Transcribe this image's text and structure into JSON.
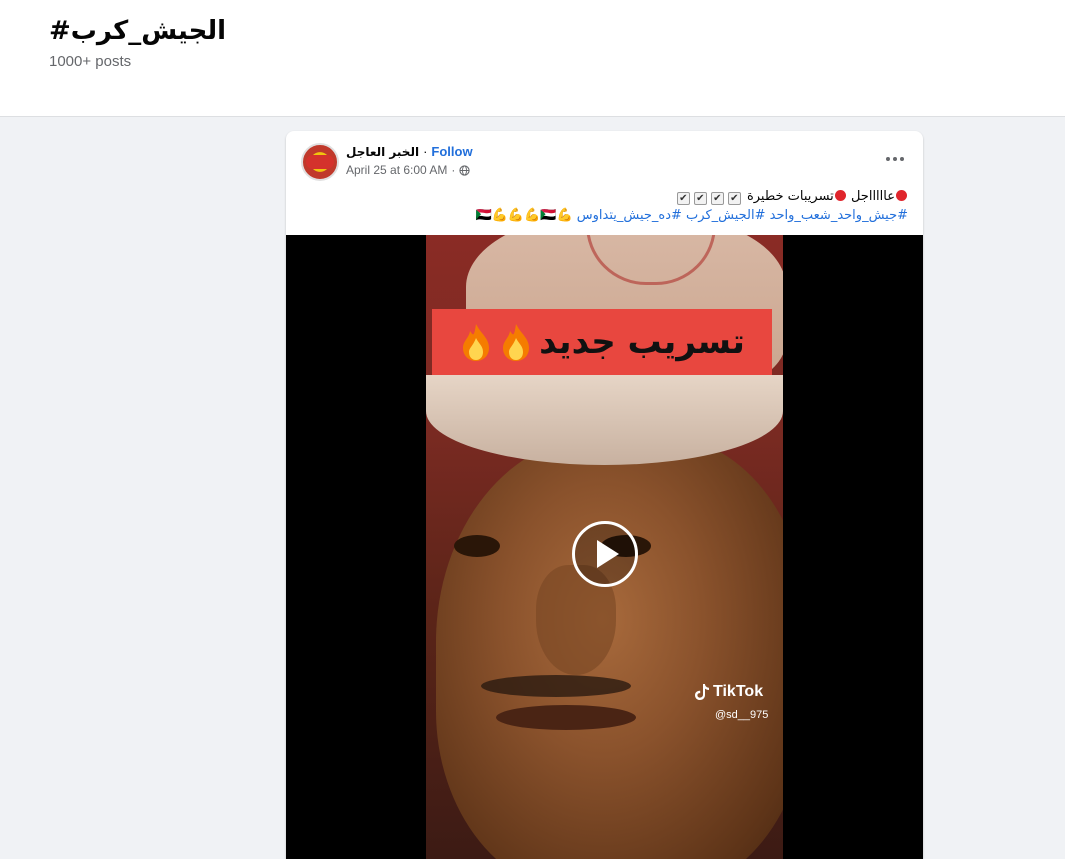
{
  "hashtag": {
    "title": "#الجيش_كرب",
    "post_count": "1000+ posts"
  },
  "post": {
    "page_name": "الخبر العاجل",
    "separator": "·",
    "follow_label": "Follow",
    "timestamp": "April 25 at 6:00 AM",
    "meta_separator": "·",
    "privacy_icon": "globe-icon",
    "more_icon": "more-options-icon",
    "caption": {
      "line1_part1": "عاااااجل",
      "line1_part2": "تسريبات خطيرة",
      "line2": "#جيش_واحد_شعب_واحد #الجيش_كرب #ده_جيش_يتداوس 💪🇸🇩💪💪💪🇸🇩"
    },
    "video": {
      "banner_text": "تسريب جديد",
      "watermark_brand": "TikTok",
      "watermark_handle": "@sd__975",
      "play_icon": "play-icon"
    }
  },
  "colors": {
    "accent": "#216fdb",
    "banner": "#e8473f",
    "background": "#f0f2f5"
  }
}
